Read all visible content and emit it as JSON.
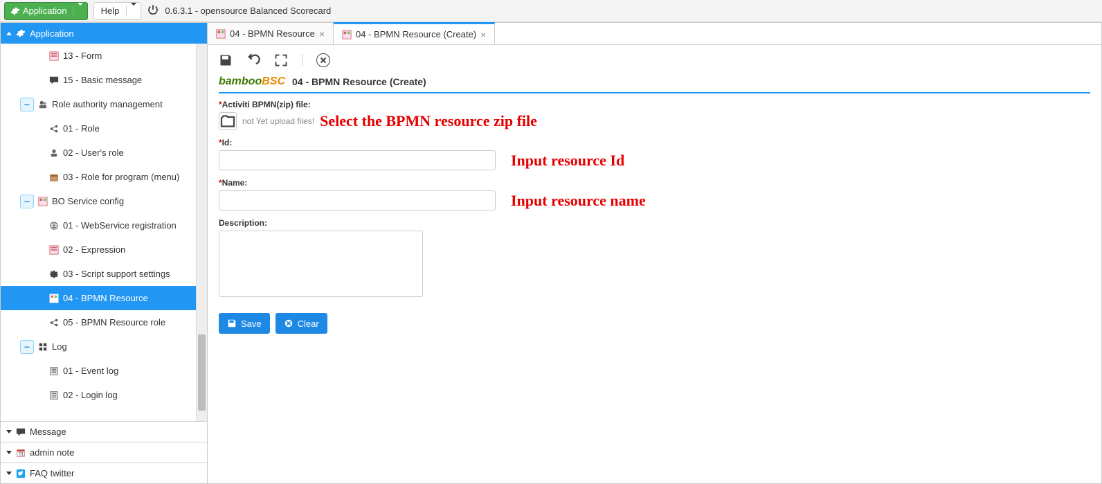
{
  "top": {
    "application_btn": "Application",
    "help_btn": "Help",
    "version_text": "0.6.3.1 - opensource Balanced Scorecard"
  },
  "sidebar": {
    "header_application": "Application",
    "header_message": "Message",
    "header_admin_note": "admin note",
    "header_faq": "FAQ twitter",
    "items": {
      "form": "13 - Form",
      "basic_message": "15 - Basic message",
      "role_mgmt": "Role authority management",
      "role": "01 - Role",
      "users_role": "02 - User's role",
      "role_program": "03 - Role for program (menu)",
      "bo_service": "BO Service config",
      "webservice": "01 - WebService registration",
      "expression": "02 - Expression",
      "script_support": "03 - Script support settings",
      "bpmn_resource": "04 - BPMN Resource",
      "bpmn_resource_role": "05 - BPMN Resource role",
      "log": "Log",
      "event_log": "01 - Event log",
      "login_log": "02 - Login log"
    }
  },
  "tabs": {
    "tab1": "04 - BPMN Resource",
    "tab2": "04 - BPMN Resource (Create)"
  },
  "brand": {
    "bamboo_green": "bamboo",
    "bamboo_orange": "BSC",
    "page_title": "04 - BPMN Resource (Create)"
  },
  "form": {
    "file_label": "Activiti BPMN(zip) file",
    "upload_msg": "not Yet upload files!",
    "file_annotation": "Select the BPMN resource zip file",
    "id_label": "Id",
    "id_annotation": "Input resource Id",
    "name_label": "Name",
    "name_annotation": "Input resource name",
    "desc_label": "Description",
    "save_btn": "Save",
    "clear_btn": "Clear",
    "id_value": "",
    "name_value": "",
    "desc_value": ""
  },
  "colors": {
    "accent": "#2196f3",
    "green": "#4caf50",
    "annotation": "#e60000"
  }
}
